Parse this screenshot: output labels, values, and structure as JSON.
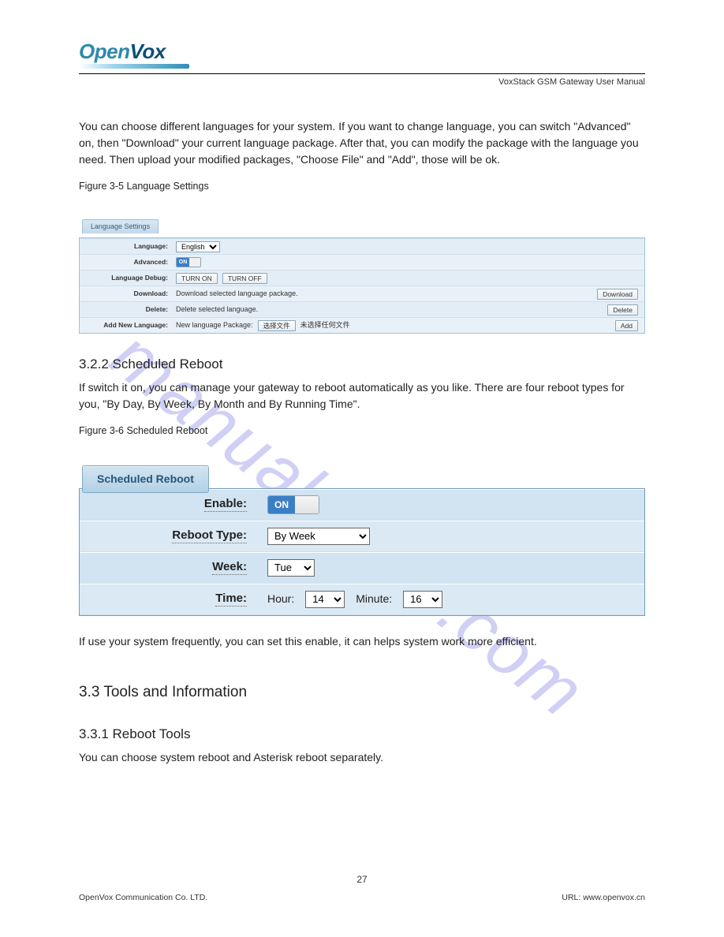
{
  "header": {
    "logo_open": "Open",
    "logo_vox": "Vox",
    "subtitle": "VoxStack GSM Gateway User Manual"
  },
  "intro": {
    "p1": "You can choose different languages for your system. If you want to change language, you can switch \"Advanced\" on, then \"Download\" your current language package. After that, you can modify the package with the language you need. Then upload your modified packages, \"Choose File\" and \"Add\", those will be ok."
  },
  "fig35": {
    "caption": "Figure 3-5 Language Settings",
    "tab": "Language Settings",
    "rows": {
      "language_lbl": "Language:",
      "language_val": "English",
      "advanced_lbl": "Advanced:",
      "advanced_on": "ON",
      "debug_lbl": "Language Debug:",
      "turn_on": "TURN ON",
      "turn_off": "TURN OFF",
      "download_lbl": "Download:",
      "download_text": "Download selected language package.",
      "download_btn": "Download",
      "delete_lbl": "Delete:",
      "delete_text": "Delete selected language.",
      "delete_btn": "Delete",
      "addnew_lbl": "Add New Language:",
      "addnew_text": "New language Package:",
      "choose_file_btn": "选择文件",
      "no_file_text": "未选择任何文件",
      "add_btn": "Add"
    }
  },
  "reboot": {
    "h3": "3.2.2 Scheduled Reboot",
    "p": "If switch it on, you can manage your gateway to reboot automatically as you like. There are four reboot types for you, \"By Day, By Week, By Month and By Running Time\".",
    "caption": "Figure 3-6 Scheduled Reboot",
    "chip": "Scheduled Reboot",
    "rows": {
      "enable_lbl": "Enable:",
      "enable_on": "ON",
      "type_lbl": "Reboot Type:",
      "type_val": "By Week",
      "week_lbl": "Week:",
      "week_val": "Tue",
      "time_lbl": "Time:",
      "hour_lbl": "Hour:",
      "hour_val": "14",
      "minute_lbl": "Minute:",
      "minute_val": "16"
    },
    "after": "If use your system frequently, you can set this enable, it can helps system work more efficient."
  },
  "tools": {
    "h2": "3.3 Tools and Information",
    "h3": "3.3.1 Reboot Tools",
    "p": "You can choose system reboot and Asterisk reboot separately."
  },
  "footer": {
    "left": "OpenVox Communication Co. LTD.",
    "right": "URL: www.openvox.cn",
    "page": "27"
  },
  "watermark": "manualshive.com"
}
